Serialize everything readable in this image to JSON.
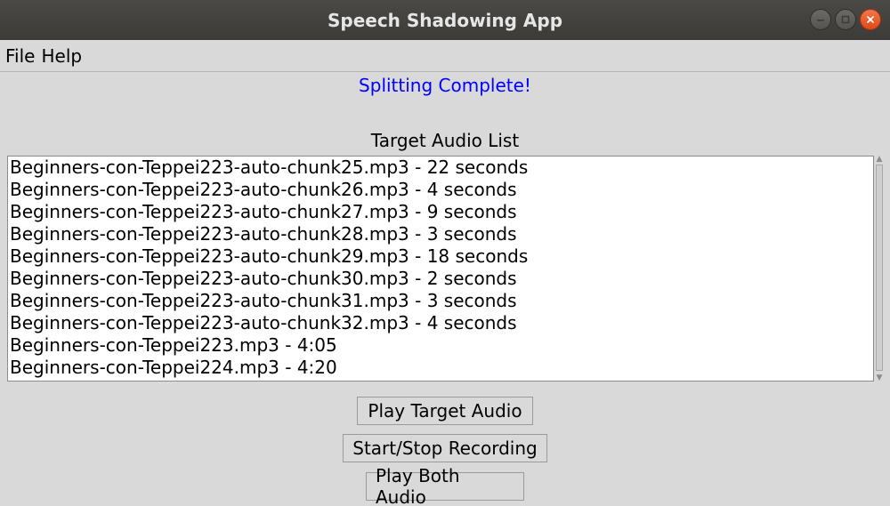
{
  "window": {
    "title": "Speech Shadowing App",
    "controls": [
      "minimize-icon",
      "maximize-icon",
      "close-icon"
    ]
  },
  "menubar": {
    "items": [
      {
        "label": "File"
      },
      {
        "label": "Help"
      }
    ]
  },
  "status": {
    "text": "Splitting Complete!",
    "color": "#0000ff"
  },
  "target_list": {
    "label": "Target Audio List",
    "items": [
      "Beginners-con-Teppei223-auto-chunk25.mp3 - 22 seconds",
      "Beginners-con-Teppei223-auto-chunk26.mp3 - 4 seconds",
      "Beginners-con-Teppei223-auto-chunk27.mp3 - 9 seconds",
      "Beginners-con-Teppei223-auto-chunk28.mp3 - 3 seconds",
      "Beginners-con-Teppei223-auto-chunk29.mp3 - 18 seconds",
      "Beginners-con-Teppei223-auto-chunk30.mp3 - 2 seconds",
      "Beginners-con-Teppei223-auto-chunk31.mp3 - 3 seconds",
      "Beginners-con-Teppei223-auto-chunk32.mp3 - 4 seconds",
      "Beginners-con-Teppei223.mp3 - 4:05",
      "Beginners-con-Teppei224.mp3 - 4:20"
    ]
  },
  "buttons": {
    "play_target": "Play Target Audio",
    "record": "Start/Stop Recording",
    "play_both": "Play Both Audio"
  }
}
